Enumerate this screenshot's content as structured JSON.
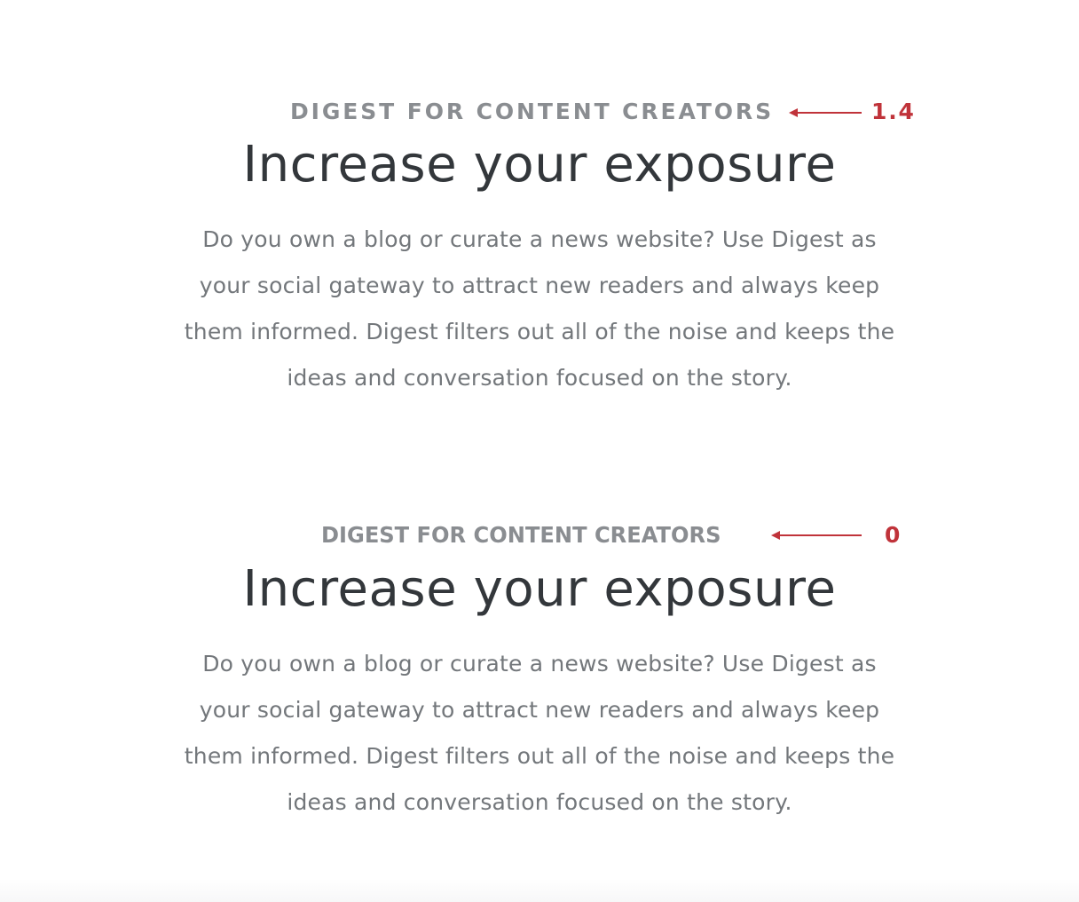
{
  "examples": [
    {
      "eyebrow": "DIGEST FOR CONTENT CREATORS",
      "annotation_value": "1.4",
      "headline": "Increase your exposure",
      "body_lines": [
        "Do you own a blog or curate a news website? Use Digest as",
        "your social gateway to attract new readers and always keep",
        "them informed. Digest filters out all of the noise and keeps the",
        "ideas and conversation focused on the story."
      ]
    },
    {
      "eyebrow": "DIGEST FOR CONTENT CREATORS",
      "annotation_value": "0",
      "headline": "Increase your exposure",
      "body_lines": [
        "Do you own a blog or curate a news website? Use Digest as",
        "your social gateway to attract new readers and always keep",
        "them informed. Digest filters out all of the noise and keeps the",
        "ideas and conversation focused on the story."
      ]
    }
  ],
  "colors": {
    "eyebrow": "#8a8d91",
    "headline": "#33373b",
    "body": "#73777b",
    "annotation": "#c0333a",
    "background": "#ffffff"
  },
  "icons": {
    "annotation_arrow": "left-arrow-icon"
  }
}
